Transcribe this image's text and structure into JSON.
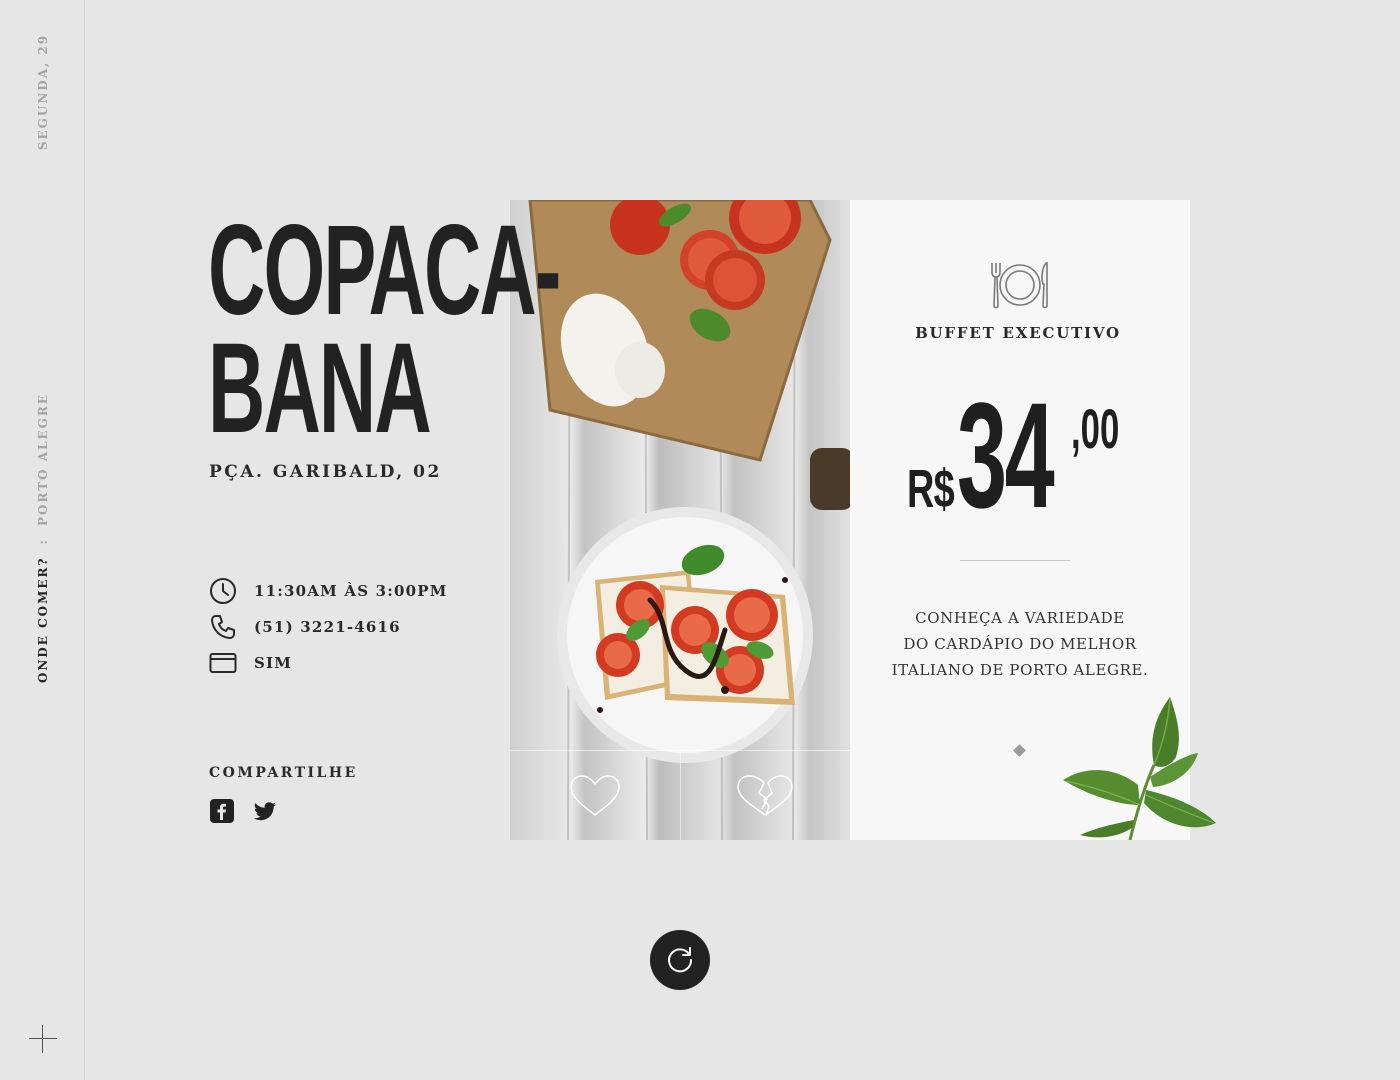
{
  "sidebar": {
    "date": "SEGUNDA, 29",
    "crumb_active": "ONDE COMER?",
    "crumb_separator": ":",
    "crumb_city": "PORTO ALEGRE"
  },
  "restaurant": {
    "name_line1": "COPACA-",
    "name_line2": "BANA",
    "address": "PÇA. GARIBALD, 02",
    "hours": "11:30AM ÀS 3:00PM",
    "phone": "(51) 3221-4616",
    "card_payment": "SIM"
  },
  "share": {
    "label": "COMPARTILHE",
    "icons": [
      "facebook-icon",
      "twitter-icon"
    ]
  },
  "menu": {
    "icon": "plate-cutlery-icon",
    "title": "BUFFET EXECUTIVO",
    "price_currency": "R$",
    "price_integer": "34",
    "price_decimal": ",00",
    "description_line1": "CONHEÇA A VARIEDADE",
    "description_line2": "DO CARDÁPIO DO MELHOR",
    "description_line3": "ITALIANO DE PORTO ALEGRE."
  },
  "actions": {
    "like_icon": "heart-icon",
    "dislike_icon": "broken-heart-icon",
    "refresh_icon": "refresh-icon"
  },
  "colors": {
    "background": "#e6e6e6",
    "card": "#f7f7f7",
    "text": "#222222",
    "muted": "#a4a4a4"
  }
}
